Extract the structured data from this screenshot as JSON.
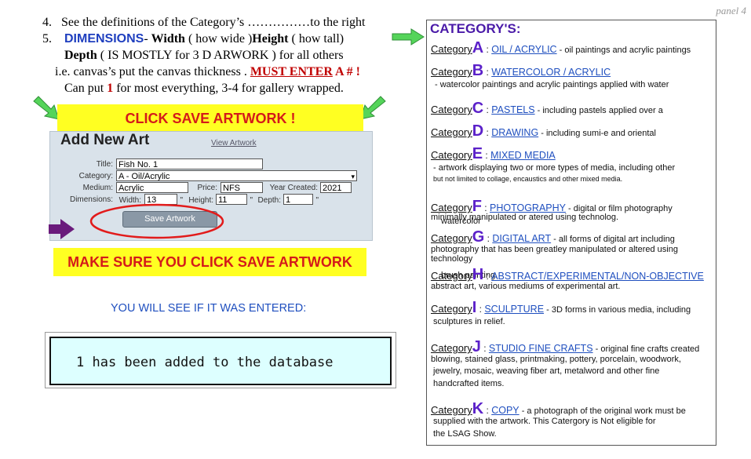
{
  "panel_label": "panel 4",
  "instructions": {
    "line4_num": "4.",
    "line4_text": "See the definitions of the Category’s ……………to the right",
    "line5_num": "5.",
    "line5_label": "DIMENSIONS",
    "line5_dash": "- ",
    "line5_width": "Width",
    "line5_mid": " ( how wide )",
    "line5_height": "Height",
    "line5_end": " ( how tall)",
    "line6_depth": "Depth",
    "line6_text": " ( IS MOSTLY for 3 D ARWORK ) for all others",
    "line7_text": "i.e. canvas’s put the canvas thickness . ",
    "line7_must": "MUST ENTER",
    "line7_a": " A # !",
    "line8_a": "Can put ",
    "line8_one": "1",
    "line8_b": " for most everything, 3-4 for gallery wrapped."
  },
  "banner_top": "CLICK SAVE ARTWORK !",
  "form": {
    "title": "Add New Art",
    "view_link": "View Artwork",
    "title_label": "Title:",
    "title_value": "Fish No. 1",
    "category_label": "Category:",
    "category_value": "A - Oil/Acrylic",
    "medium_label": "Medium:",
    "medium_value": "Acrylic",
    "price_label": "Price:",
    "price_value": "NFS",
    "year_label": "Year Created:",
    "year_value": "2021",
    "dimensions_label": "Dimensions:",
    "width_label": "Width:",
    "width_value": "13",
    "width_unit": "\"",
    "height_label": "Height:",
    "height_value": "11",
    "height_unit": "\"",
    "depth_label": "Depth:",
    "depth_value": "1",
    "depth_unit": "\"",
    "save_button": "Save Artwork"
  },
  "banner_bottom": "MAKE SURE YOU CLICK SAVE ARTWORK",
  "result_heading": "YOU WILL SEE IF IT WAS ENTERED:",
  "result_message": "1 has been added to the database",
  "categories_title": "CATEGORY'S:",
  "category_word": "Category",
  "categories": [
    {
      "letter": "A",
      "name": "OIL / ACRYLIC",
      "desc": " - oil paintings and acrylic paintings",
      "extra": []
    },
    {
      "letter": "B",
      "name": "WATERCOLOR / ACRYLIC",
      "desc": "",
      "extra": [
        "- watercolor paintings and acrylic paintings applied with water"
      ]
    },
    {
      "letter": "C",
      "name": "PASTELS",
      "desc": " - including pastels applied over a",
      "extra": [
        "watercolor"
      ]
    },
    {
      "letter": "D",
      "name": "DRAWING",
      "desc": " - including sumi-e and oriental",
      "extra": [
        "brush painting."
      ]
    },
    {
      "letter": "E",
      "name": "MIXED MEDIA",
      "desc": "",
      "extra": [
        "- artwork displaying two or more types of media, including other",
        "but not limited to collage, encaustics and other mixed media."
      ]
    },
    {
      "letter": "F",
      "name": "PHOTOGRAPHY",
      "desc": " - digital or film photography",
      "extra": [
        "minimally manipulated or atered using technolog."
      ]
    },
    {
      "letter": "G",
      "name": "DIGITAL ART",
      "desc": " - all forms of digital art  including",
      "extra": [
        "photography that has been greatley manipulated or altered using",
        "technology"
      ]
    },
    {
      "letter": "H",
      "name": "ABSTRACT/EXPERIMENTAL/NON-OBJECTIVE",
      "desc": "",
      "extra": [
        "abstract art, various mediums of experimental art."
      ]
    },
    {
      "letter": "I",
      "name": "SCULPTURE",
      "desc": " - 3D forms in various media, including",
      "extra": [
        "sculptures in relief."
      ]
    },
    {
      "letter": "J",
      "name": "STUDIO FINE CRAFTS",
      "desc": " - original fine crafts created",
      "extra": [
        "blowing, stained glass, printmaking, pottery, porcelain, woodwork,",
        "jewelry, mosaic, weaving fiber art, metalword and other fine",
        "handcrafted items."
      ]
    },
    {
      "letter": "K",
      "name": "COPY",
      "desc": " - a photograph of the original work must be",
      "extra": [
        "supplied with the artwork. This Catergory is Not eligible for",
        "the LSAG Show."
      ]
    }
  ]
}
